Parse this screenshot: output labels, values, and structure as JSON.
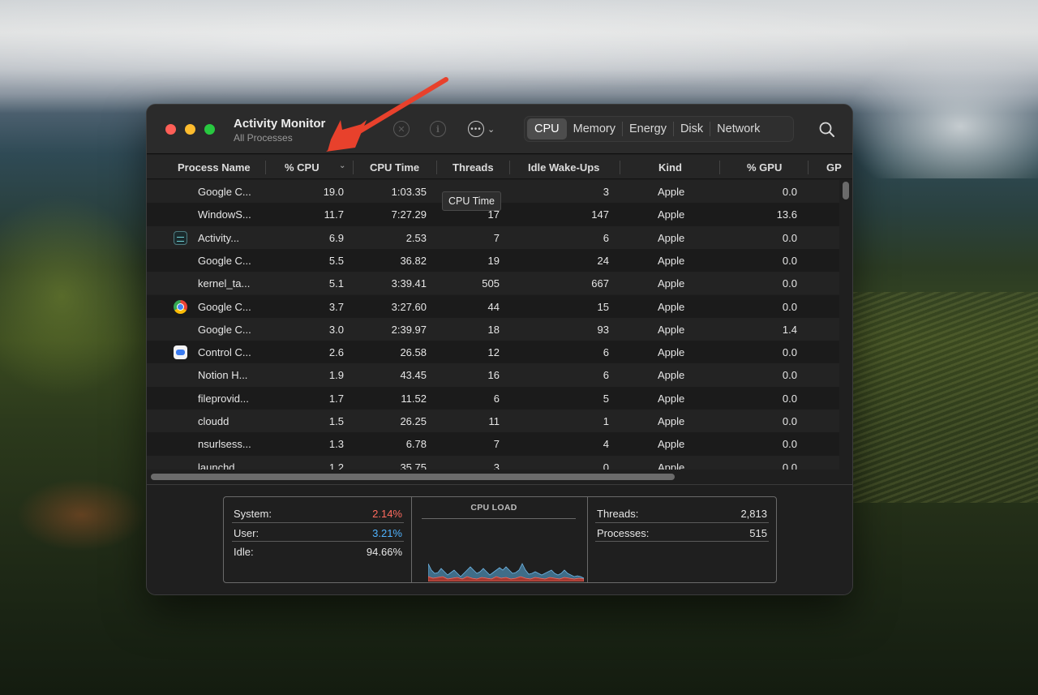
{
  "window": {
    "title": "Activity Monitor",
    "subtitle": "All Processes"
  },
  "toolbar": {
    "stop_icon": "x-circle-icon",
    "info_icon": "info-circle-icon",
    "more_icon": "ellipsis-circle-icon",
    "tabs": [
      {
        "label": "CPU",
        "active": true
      },
      {
        "label": "Memory",
        "active": false
      },
      {
        "label": "Energy",
        "active": false
      },
      {
        "label": "Disk",
        "active": false
      },
      {
        "label": "Network",
        "active": false
      }
    ],
    "search_icon": "magnifier-icon"
  },
  "columns": [
    "Process Name",
    "% CPU",
    "CPU Time",
    "Threads",
    "Idle Wake-Ups",
    "Kind",
    "% GPU",
    "GP"
  ],
  "tooltip": "CPU Time",
  "rows": [
    {
      "icon": "none",
      "name": "Google C...",
      "cpu": "19.0",
      "time": "1:03.35",
      "threads": "",
      "wake": "3",
      "kind": "Apple",
      "gpu": "0.0"
    },
    {
      "icon": "none",
      "name": "WindowS...",
      "cpu": "11.7",
      "time": "7:27.29",
      "threads": "17",
      "wake": "147",
      "kind": "Apple",
      "gpu": "13.6"
    },
    {
      "icon": "activity-monitor-icon",
      "name": "Activity...",
      "cpu": "6.9",
      "time": "2.53",
      "threads": "7",
      "wake": "6",
      "kind": "Apple",
      "gpu": "0.0"
    },
    {
      "icon": "none",
      "name": "Google C...",
      "cpu": "5.5",
      "time": "36.82",
      "threads": "19",
      "wake": "24",
      "kind": "Apple",
      "gpu": "0.0"
    },
    {
      "icon": "none",
      "name": "kernel_ta...",
      "cpu": "5.1",
      "time": "3:39.41",
      "threads": "505",
      "wake": "667",
      "kind": "Apple",
      "gpu": "0.0"
    },
    {
      "icon": "chrome-icon",
      "name": "Google C...",
      "cpu": "3.7",
      "time": "3:27.60",
      "threads": "44",
      "wake": "15",
      "kind": "Apple",
      "gpu": "0.0"
    },
    {
      "icon": "none",
      "name": "Google C...",
      "cpu": "3.0",
      "time": "2:39.97",
      "threads": "18",
      "wake": "93",
      "kind": "Apple",
      "gpu": "1.4"
    },
    {
      "icon": "control-center-icon",
      "name": "Control C...",
      "cpu": "2.6",
      "time": "26.58",
      "threads": "12",
      "wake": "6",
      "kind": "Apple",
      "gpu": "0.0"
    },
    {
      "icon": "none",
      "name": "Notion H...",
      "cpu": "1.9",
      "time": "43.45",
      "threads": "16",
      "wake": "6",
      "kind": "Apple",
      "gpu": "0.0"
    },
    {
      "icon": "none",
      "name": "fileprovid...",
      "cpu": "1.7",
      "time": "11.52",
      "threads": "6",
      "wake": "5",
      "kind": "Apple",
      "gpu": "0.0"
    },
    {
      "icon": "none",
      "name": "cloudd",
      "cpu": "1.5",
      "time": "26.25",
      "threads": "11",
      "wake": "1",
      "kind": "Apple",
      "gpu": "0.0"
    },
    {
      "icon": "none",
      "name": "nsurlsess...",
      "cpu": "1.3",
      "time": "6.78",
      "threads": "7",
      "wake": "4",
      "kind": "Apple",
      "gpu": "0.0"
    },
    {
      "icon": "none",
      "name": "launchd",
      "cpu": "1.2",
      "time": "35.75",
      "threads": "3",
      "wake": "0",
      "kind": "Apple",
      "gpu": "0.0"
    }
  ],
  "summary": {
    "system_label": "System:",
    "system_value": "2.14%",
    "user_label": "User:",
    "user_value": "3.21%",
    "idle_label": "Idle:",
    "idle_value": "94.66%",
    "cpu_load_title": "CPU LOAD",
    "threads_label": "Threads:",
    "threads_value": "2,813",
    "processes_label": "Processes:",
    "processes_value": "515"
  },
  "colors": {
    "system": "#ff6b5e",
    "user": "#4fb3ff",
    "arrow": "#e8412c"
  }
}
